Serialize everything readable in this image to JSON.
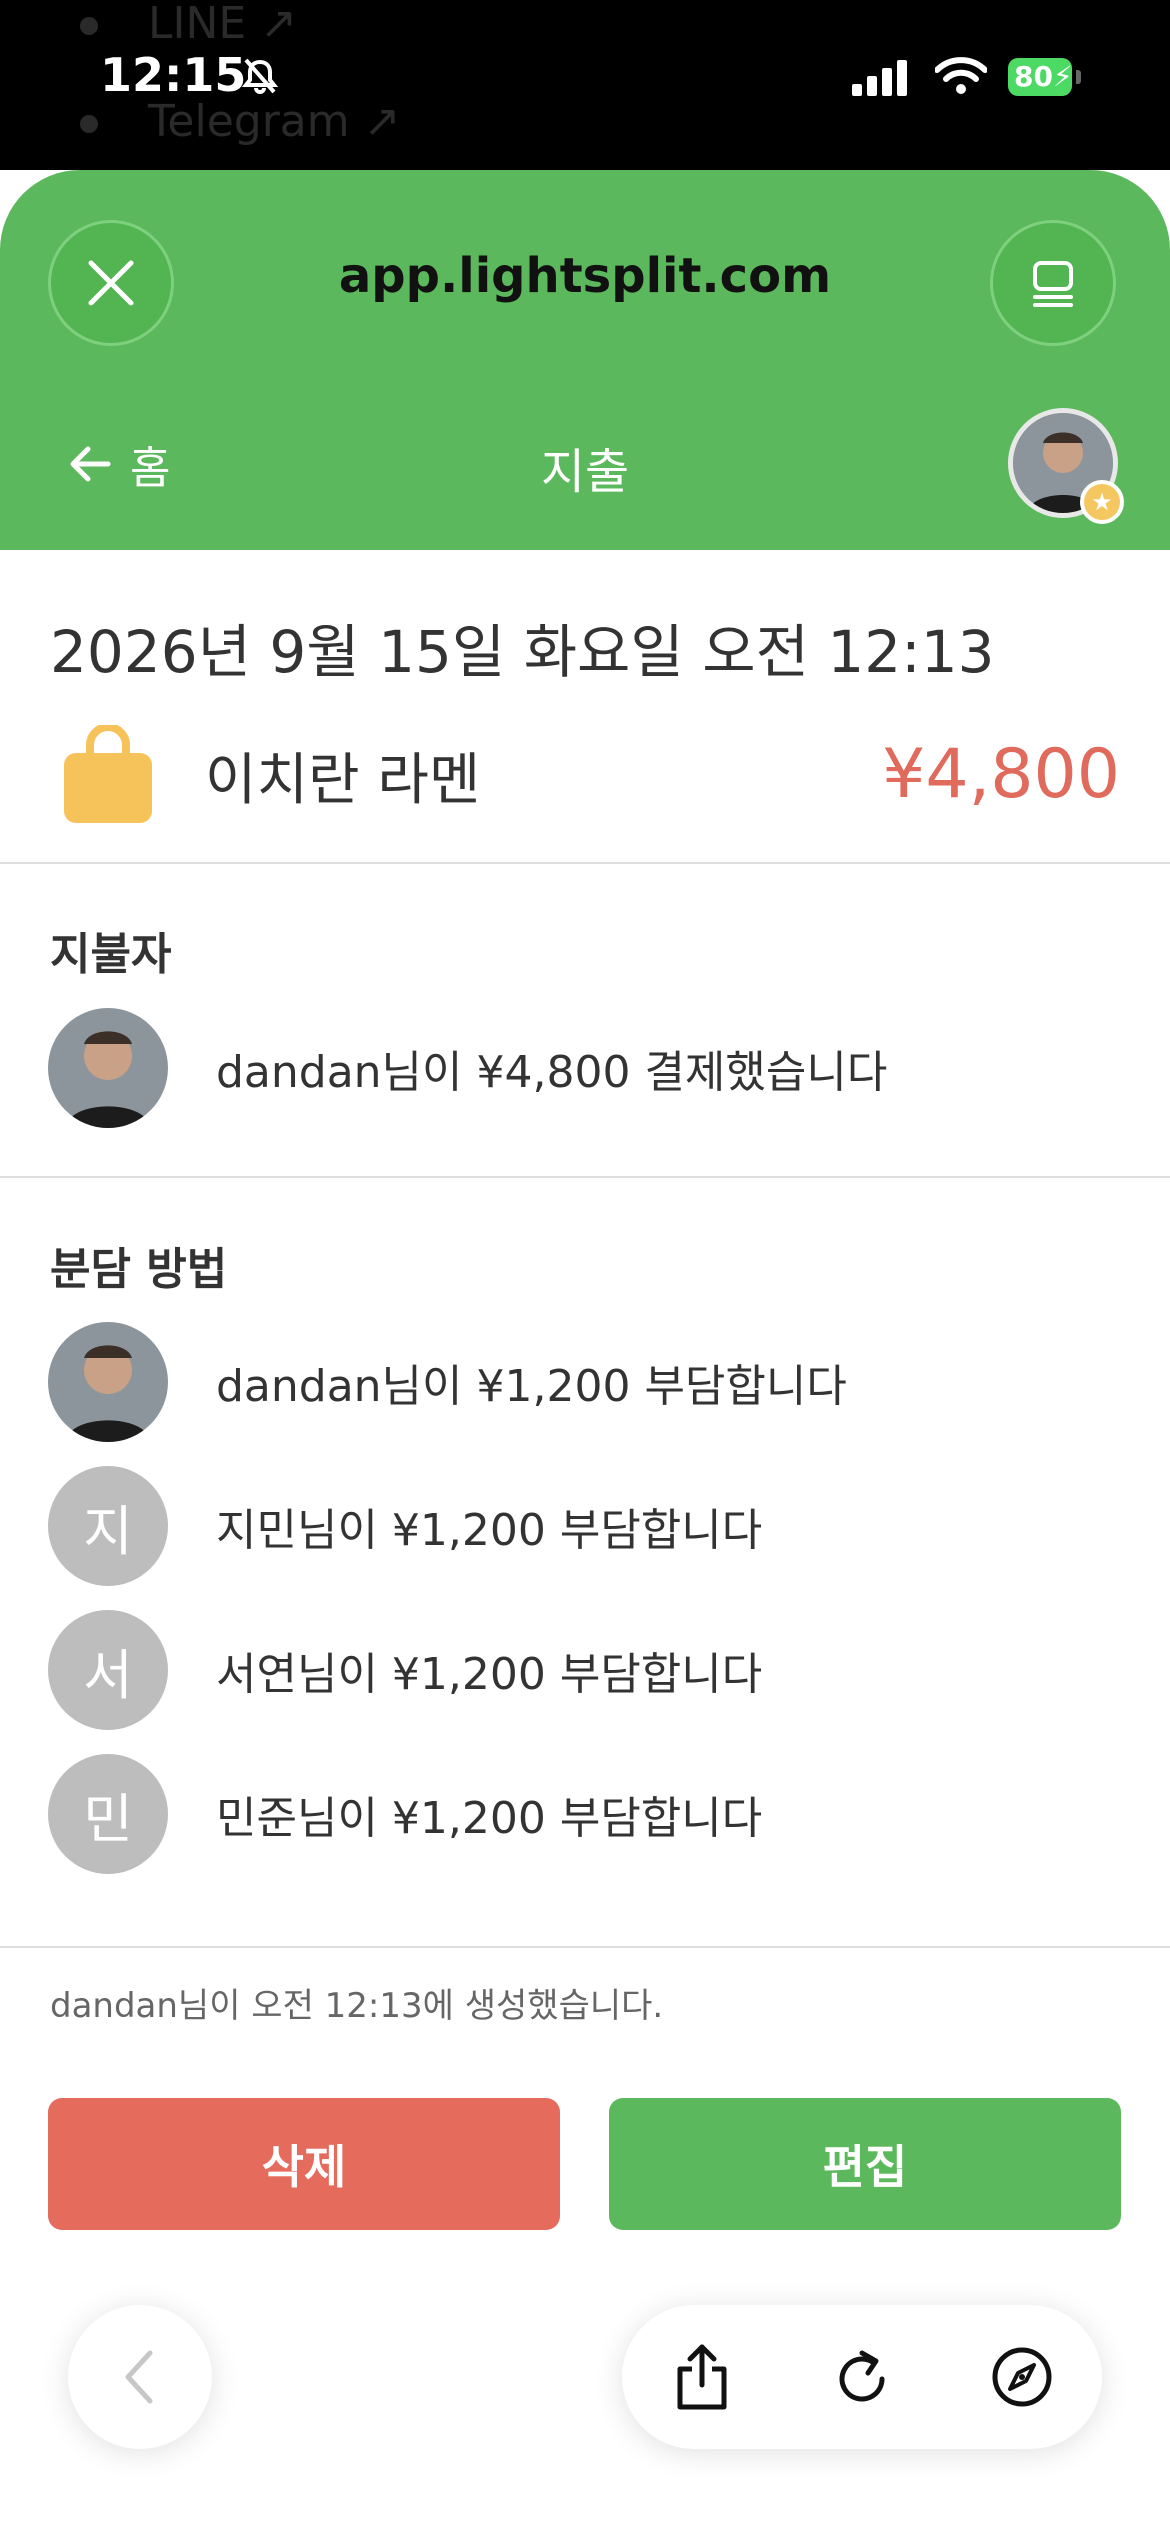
{
  "status_bar": {
    "time": "12:15",
    "battery": "80",
    "background_links": [
      "LINE",
      "Telegram"
    ]
  },
  "browser": {
    "url": "app.lightsplit.com"
  },
  "nav": {
    "back_label": "홈",
    "title": "지출"
  },
  "expense": {
    "datetime": "2026년 9월 15일 화요일 오전 12:13",
    "name": "이치란 라멘",
    "amount": "¥4,800"
  },
  "payer": {
    "section_title": "지불자",
    "text": "dandan님이 ¥4,800 결제했습니다"
  },
  "split": {
    "section_title": "분담 방법",
    "rows": [
      {
        "avatar": "photo",
        "text": "dandan님이 ¥1,200 부담합니다"
      },
      {
        "avatar": "지",
        "text": "지민님이 ¥1,200 부담합니다"
      },
      {
        "avatar": "서",
        "text": "서연님이 ¥1,200 부담합니다"
      },
      {
        "avatar": "민",
        "text": "민준님이 ¥1,200 부담합니다"
      }
    ]
  },
  "footer_note": "dandan님이 오전 12:13에 생성했습니다.",
  "actions": {
    "delete_label": "삭제",
    "edit_label": "편집"
  },
  "colors": {
    "brand_green": "#5cb85c",
    "danger_red": "#e56b5d",
    "amount_red": "#e06a5c",
    "bag_yellow": "#f5c35a"
  },
  "icons": [
    "close-icon",
    "tabs-icon",
    "arrow-left-icon",
    "shopping-bag-icon",
    "share-icon",
    "reload-icon",
    "compass-icon",
    "chevron-left-icon"
  ]
}
